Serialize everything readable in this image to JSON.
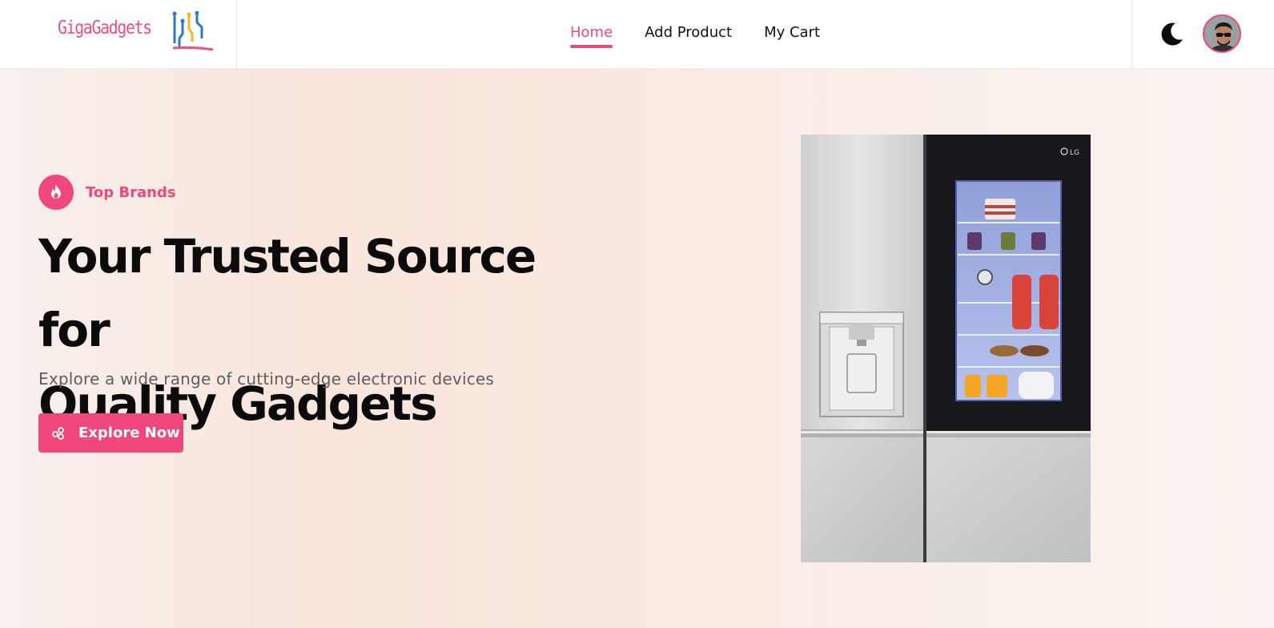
{
  "brand": {
    "name": "GigaGadgets",
    "accent_color": "#f0487c"
  },
  "nav": {
    "items": [
      {
        "label": "Home",
        "active": true
      },
      {
        "label": "Add Product",
        "active": false
      },
      {
        "label": "My Cart",
        "active": false
      }
    ]
  },
  "header_actions": {
    "theme_icon": "moon-icon",
    "avatar_icon": "user-avatar"
  },
  "hero": {
    "badge_label": "Top Brands",
    "badge_icon": "flame-icon",
    "headline_line1": "Your Trusted Source for",
    "headline_line2": "Quality Gadgets",
    "subtitle": "Explore a wide range of cutting-edge electronic devices",
    "cta_label": "Explore Now",
    "cta_icon": "molecule-icon",
    "product_image": "refrigerator-image"
  }
}
